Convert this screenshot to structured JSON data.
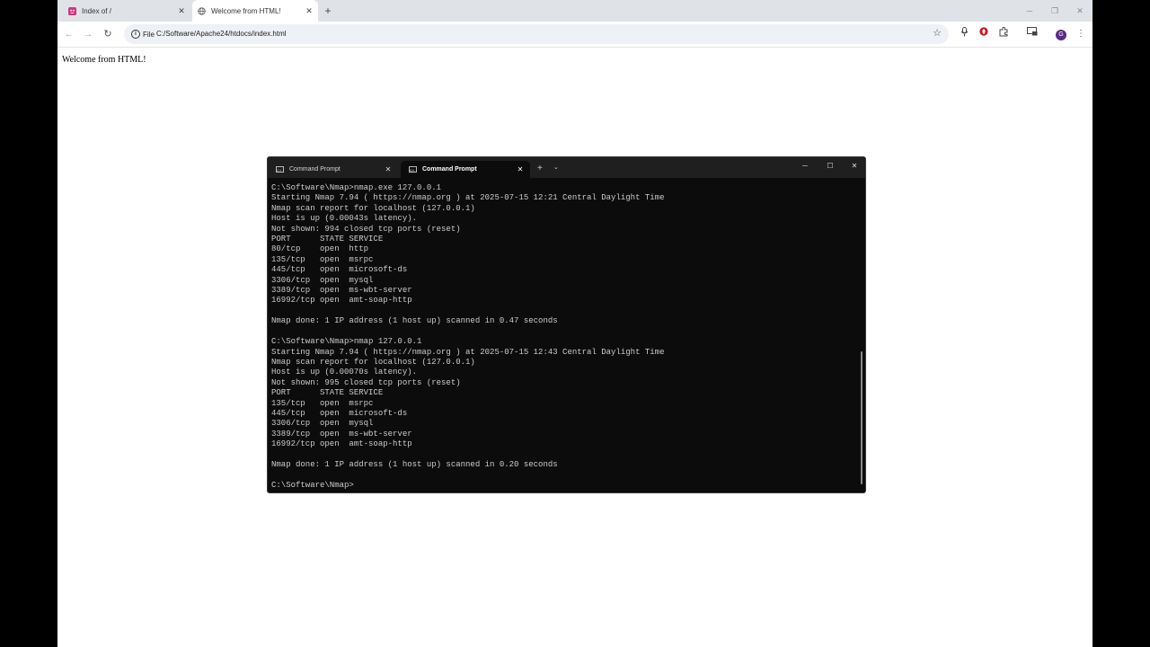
{
  "browser": {
    "tabs": [
      {
        "title": "Index of /",
        "active": false
      },
      {
        "title": "Welcome from HTML!",
        "active": true
      }
    ],
    "address": {
      "scheme_label": "File",
      "url": "C:/Software/Apache24/htdocs/index.html"
    },
    "profile_initial": "G"
  },
  "page": {
    "body_text": "Welcome from HTML!"
  },
  "terminal": {
    "tabs": [
      {
        "title": "Command Prompt",
        "active": false
      },
      {
        "title": "Command Prompt",
        "active": true
      }
    ],
    "lines": [
      "C:\\Software\\Nmap>nmap.exe 127.0.0.1",
      "Starting Nmap 7.94 ( https://nmap.org ) at 2025-07-15 12:21 Central Daylight Time",
      "Nmap scan report for localhost (127.0.0.1)",
      "Host is up (0.00043s latency).",
      "Not shown: 994 closed tcp ports (reset)",
      "PORT      STATE SERVICE",
      "80/tcp    open  http",
      "135/tcp   open  msrpc",
      "445/tcp   open  microsoft-ds",
      "3306/tcp  open  mysql",
      "3389/tcp  open  ms-wbt-server",
      "16992/tcp open  amt-soap-http",
      "",
      "Nmap done: 1 IP address (1 host up) scanned in 0.47 seconds",
      "",
      "C:\\Software\\Nmap>nmap 127.0.0.1",
      "Starting Nmap 7.94 ( https://nmap.org ) at 2025-07-15 12:43 Central Daylight Time",
      "Nmap scan report for localhost (127.0.0.1)",
      "Host is up (0.00070s latency).",
      "Not shown: 995 closed tcp ports (reset)",
      "PORT      STATE SERVICE",
      "135/tcp   open  msrpc",
      "445/tcp   open  microsoft-ds",
      "3306/tcp  open  mysql",
      "3389/tcp  open  ms-wbt-server",
      "16992/tcp open  amt-soap-http",
      "",
      "Nmap done: 1 IP address (1 host up) scanned in 0.20 seconds",
      "",
      "C:\\Software\\Nmap>"
    ]
  },
  "icons": {
    "tab1_favicon": "apache-index-favicon",
    "tab2_favicon": "globe-icon",
    "back": "arrow-left-icon",
    "forward": "arrow-right-icon",
    "reload": "reload-icon",
    "bookmark": "star-icon",
    "mic": "microphone-icon",
    "extension1": "opera-extension-icon",
    "extensions": "puzzle-icon",
    "cast": "cast-icon",
    "menu": "kebab-menu-icon"
  },
  "colors": {
    "tabstrip_bg": "#dfe3e8",
    "omnibox_bg": "#eef1f6",
    "terminal_bg": "#0c0c0c",
    "terminal_text": "#cccccc",
    "profile_bg": "#5b2a86"
  }
}
